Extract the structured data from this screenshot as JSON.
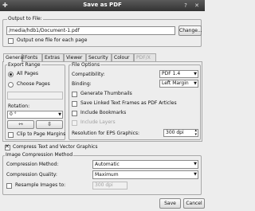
{
  "window": {
    "title": "Save as PDF",
    "app_icon": "✚",
    "help_glyph": "?",
    "close_glyph": "✕"
  },
  "output": {
    "group_label": "Output to File:",
    "path": "/media/hdb1/Document-1.pdf",
    "change_button": "Change...",
    "one_file_per_page": "Output one file for each page"
  },
  "tabs": [
    "General",
    "Fonts",
    "Extras",
    "Viewer",
    "Security",
    "Colour",
    "PDF/X"
  ],
  "export_range": {
    "label": "Export Range",
    "all_pages": "All Pages",
    "choose_pages": "Choose Pages",
    "rotation_label": "Rotation:",
    "rotation_value": "0 °",
    "clip": "Clip to Page Margins"
  },
  "file_options": {
    "label": "File Options",
    "compatibility_label": "Compatibility:",
    "compatibility_value": "PDF 1.4",
    "binding_label": "Binding:",
    "binding_value": "Left Margin",
    "generate_thumbnails": "Generate Thumbnails",
    "save_linked_frames": "Save Linked Text Frames as PDF Articles",
    "include_bookmarks": "Include Bookmarks",
    "include_layers": "Include Layers",
    "resolution_label": "Resolution for EPS Graphics:",
    "resolution_value": "300 dpi"
  },
  "compress": {
    "label": "Compress Text and Vector Graphics"
  },
  "image_compression": {
    "label": "Image Compression Method",
    "method_label": "Compression Method:",
    "method_value": "Automatic",
    "quality_label": "Compression Quality:",
    "quality_value": "Maximum",
    "resample_label": "Resample Images to:",
    "resample_value": "300 dpi"
  },
  "buttons": {
    "save": "Save",
    "cancel": "Cancel"
  }
}
